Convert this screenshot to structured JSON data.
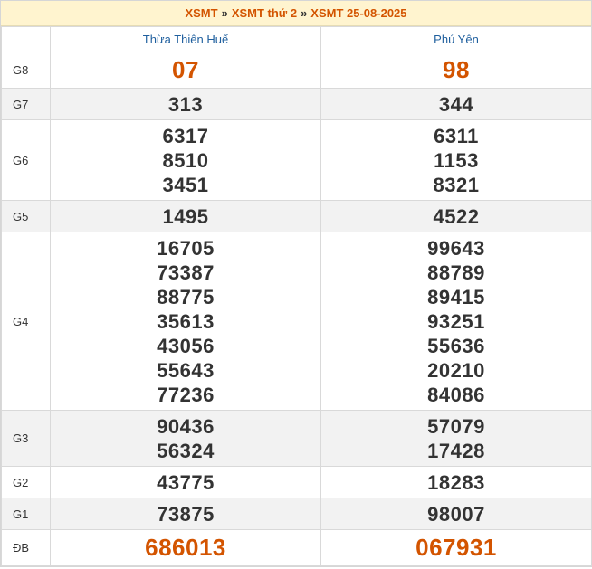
{
  "breadcrumb": {
    "items": [
      "XSMT",
      "XSMT thứ 2",
      "XSMT 25-08-2025"
    ],
    "separator": "»"
  },
  "provinces": [
    "Thừa Thiên Huế",
    "Phú Yên"
  ],
  "prizes": [
    {
      "label": "G8",
      "style": "hot",
      "values": [
        [
          "07"
        ],
        [
          "98"
        ]
      ]
    },
    {
      "label": "G7",
      "style": "alt",
      "values": [
        [
          "313"
        ],
        [
          "344"
        ]
      ]
    },
    {
      "label": "G6",
      "style": "",
      "values": [
        [
          "6317",
          "8510",
          "3451"
        ],
        [
          "6311",
          "1153",
          "8321"
        ]
      ]
    },
    {
      "label": "G5",
      "style": "alt",
      "values": [
        [
          "1495"
        ],
        [
          "4522"
        ]
      ]
    },
    {
      "label": "G4",
      "style": "",
      "values": [
        [
          "16705",
          "73387",
          "88775",
          "35613",
          "43056",
          "55643",
          "77236"
        ],
        [
          "99643",
          "88789",
          "89415",
          "93251",
          "55636",
          "20210",
          "84086"
        ]
      ]
    },
    {
      "label": "G3",
      "style": "alt",
      "values": [
        [
          "90436",
          "56324"
        ],
        [
          "57079",
          "17428"
        ]
      ]
    },
    {
      "label": "G2",
      "style": "",
      "values": [
        [
          "43775"
        ],
        [
          "18283"
        ]
      ]
    },
    {
      "label": "G1",
      "style": "alt",
      "values": [
        [
          "73875"
        ],
        [
          "98007"
        ]
      ]
    },
    {
      "label": "ĐB",
      "style": "special",
      "values": [
        [
          "686013"
        ],
        [
          "067931"
        ]
      ]
    }
  ],
  "colors": {
    "accent": "#d35400",
    "header_bg": "#fff4cf",
    "province": "#1f5f9e",
    "alt_row": "#f2f2f2"
  }
}
